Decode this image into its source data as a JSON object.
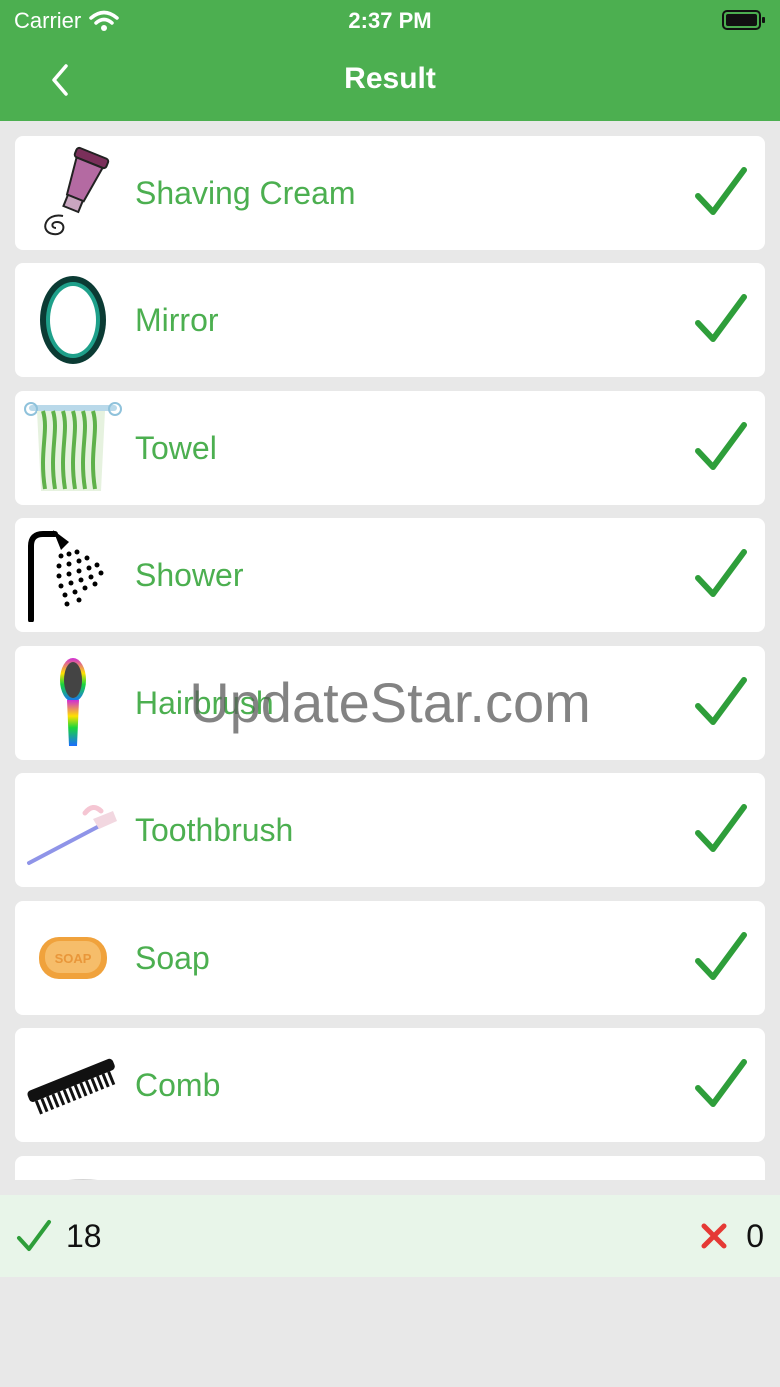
{
  "status_bar": {
    "carrier": "Carrier",
    "time": "2:37 PM"
  },
  "nav": {
    "title": "Result"
  },
  "items": [
    {
      "label": "Shaving Cream",
      "icon": "shaving-cream-icon"
    },
    {
      "label": "Mirror",
      "icon": "mirror-icon"
    },
    {
      "label": "Towel",
      "icon": "towel-icon"
    },
    {
      "label": "Shower",
      "icon": "shower-icon"
    },
    {
      "label": "Hairbrush",
      "icon": "hairbrush-icon"
    },
    {
      "label": "Toothbrush",
      "icon": "toothbrush-icon"
    },
    {
      "label": "Soap",
      "icon": "soap-icon"
    },
    {
      "label": "Comb",
      "icon": "comb-icon"
    }
  ],
  "watermark": "UpdateStar.com",
  "score": {
    "correct": "18",
    "wrong": "0"
  },
  "colors": {
    "accent": "#4caf50",
    "wrong": "#e53935",
    "background": "#e8e8e8"
  }
}
